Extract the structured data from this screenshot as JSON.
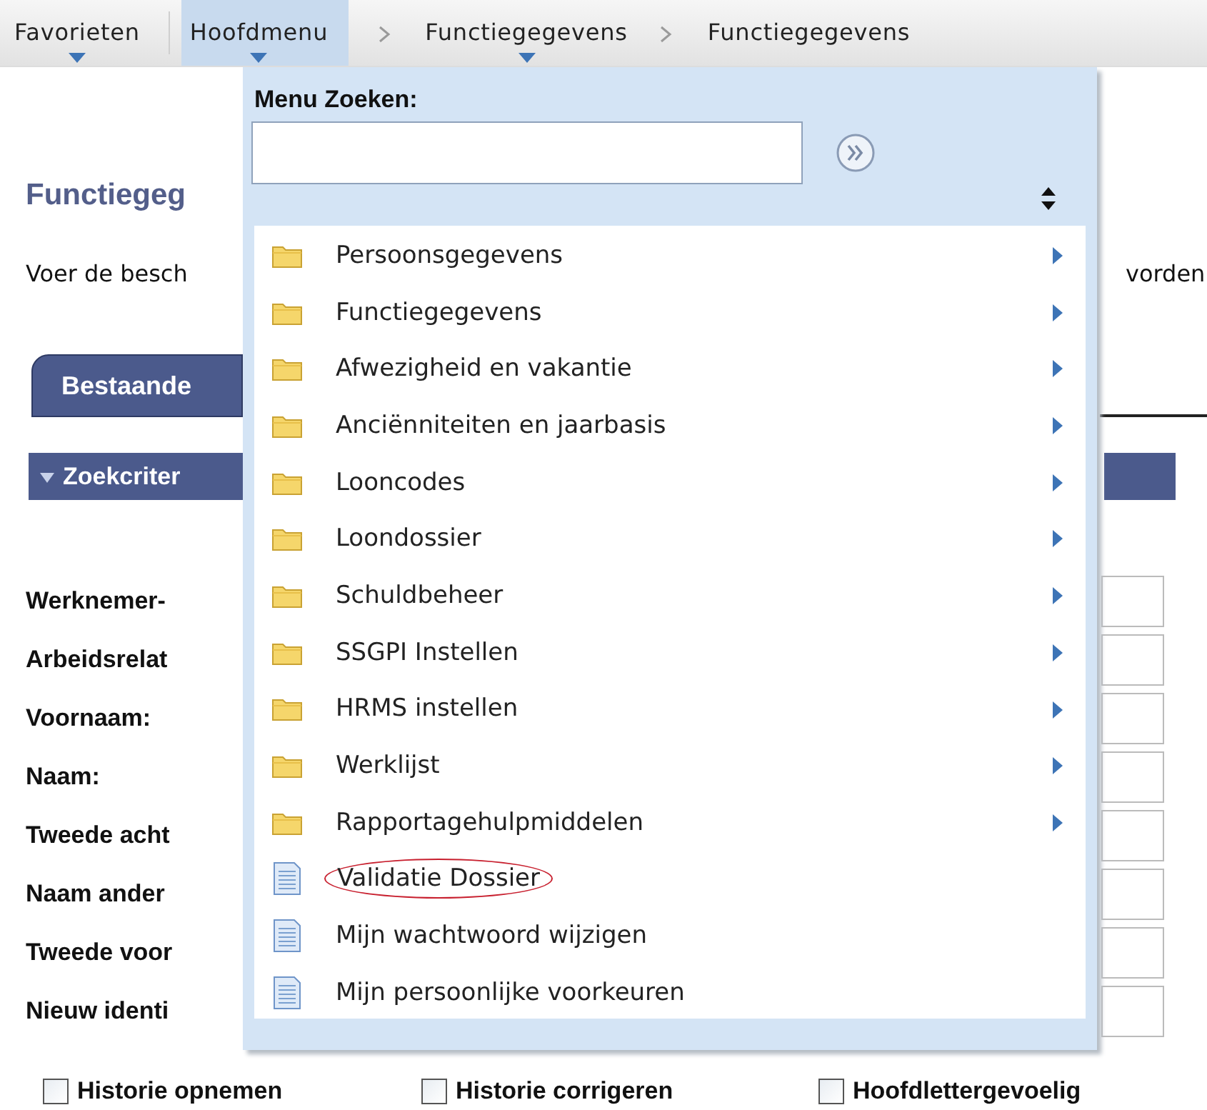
{
  "nav": {
    "items": [
      {
        "label": "Favorieten",
        "kind": "first",
        "dropdown": true,
        "open": false
      },
      {
        "label": "Hoofdmenu",
        "kind": "after-divider",
        "dropdown": true,
        "open": true
      },
      {
        "label": "Functiegegevens",
        "kind": "crumb",
        "dropdown": true,
        "open": false
      },
      {
        "label": "Functiegegevens",
        "kind": "crumb",
        "dropdown": false,
        "open": false
      }
    ]
  },
  "page": {
    "title": "Functiegeg",
    "intro": "Voer de besch",
    "intro_end": "vorden",
    "tab": {
      "label": "Bestaande",
      "selected": true
    },
    "section": {
      "label": "Zoekcriter",
      "expanded": true
    },
    "fields": [
      "Werknemer-",
      "Arbeidsrelat",
      "Voornaam:",
      "Naam:",
      "Tweede acht",
      "Naam ander",
      "Tweede voor",
      "Nieuw identi"
    ],
    "checkboxes": [
      {
        "label": "Historie opnemen",
        "checked": false
      },
      {
        "label": "Historie corrigeren",
        "checked": false
      },
      {
        "label": "Hoofdlettergevoelig",
        "checked": false
      }
    ]
  },
  "menu": {
    "search_label": "Menu Zoeken:",
    "items": [
      {
        "label": "Persoonsgegevens",
        "kind": "folder",
        "circled": false
      },
      {
        "label": "Functiegegevens",
        "kind": "folder",
        "circled": false
      },
      {
        "label": "Afwezigheid en vakantie",
        "kind": "folder",
        "circled": false
      },
      {
        "label": "Anciënniteiten en jaarbasis",
        "kind": "folder",
        "circled": false
      },
      {
        "label": "Looncodes",
        "kind": "folder",
        "circled": false
      },
      {
        "label": "Loondossier",
        "kind": "folder",
        "circled": false
      },
      {
        "label": "Schuldbeheer",
        "kind": "folder",
        "circled": false
      },
      {
        "label": "SSGPI Instellen",
        "kind": "folder",
        "circled": false
      },
      {
        "label": "HRMS instellen",
        "kind": "folder",
        "circled": false
      },
      {
        "label": "Werklijst",
        "kind": "folder",
        "circled": false
      },
      {
        "label": "Rapportagehulpmiddelen",
        "kind": "folder",
        "circled": false
      },
      {
        "label": "Validatie Dossier",
        "kind": "page",
        "circled": true
      },
      {
        "label": "Mijn wachtwoord wijzigen",
        "kind": "page",
        "circled": false
      },
      {
        "label": "Mijn persoonlijke voorkeuren",
        "kind": "page",
        "circled": false
      }
    ]
  }
}
